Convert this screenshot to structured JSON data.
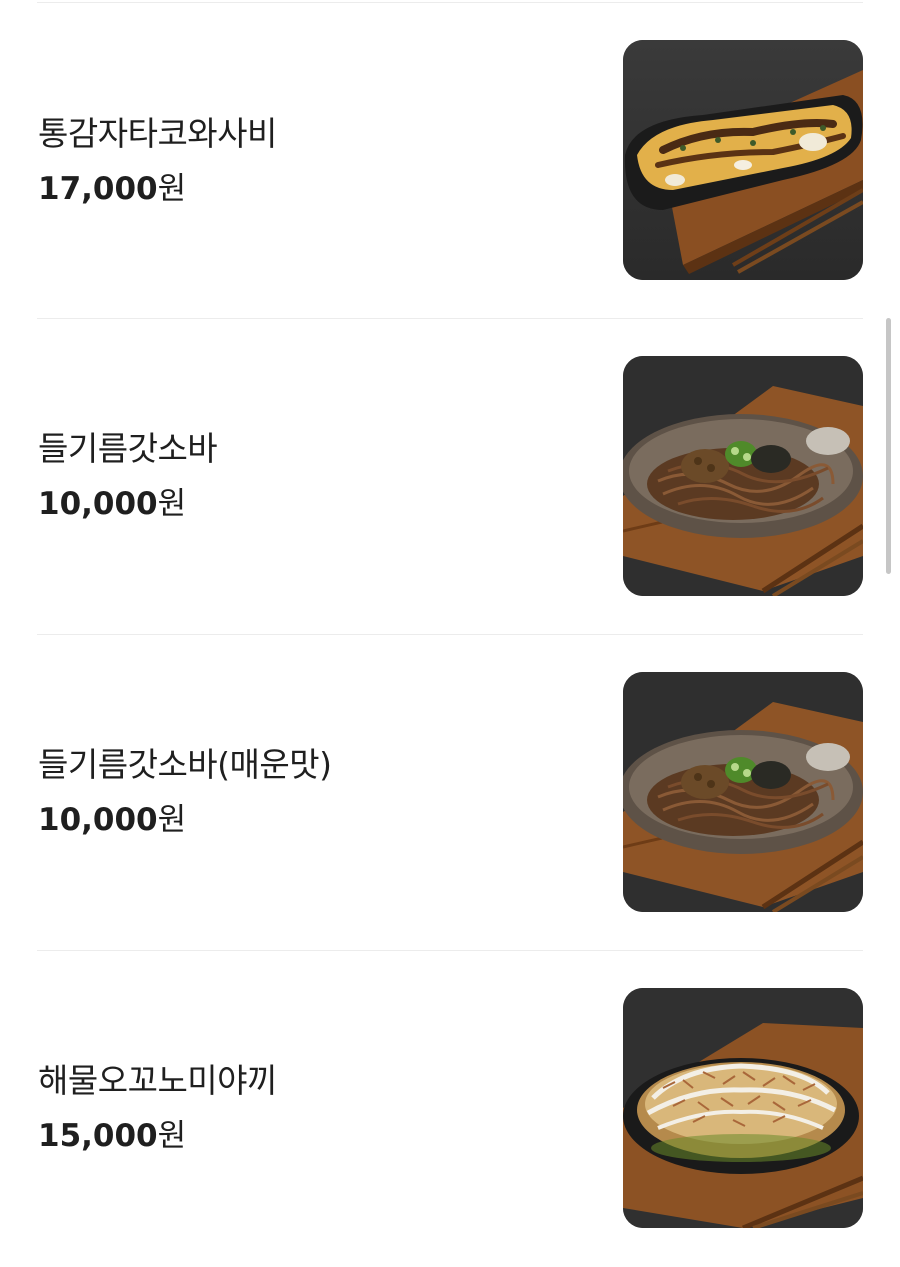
{
  "menu": {
    "items": [
      {
        "name": "통감자타코와사비",
        "price_number": "17,000",
        "price_unit": "원",
        "image": "potato-takowasabi-photo"
      },
      {
        "name": "들기름갓소바",
        "price_number": "10,000",
        "price_unit": "원",
        "image": "perilla-oil-soba-photo"
      },
      {
        "name": "들기름갓소바(매운맛)",
        "price_number": "10,000",
        "price_unit": "원",
        "image": "perilla-oil-soba-spicy-photo"
      },
      {
        "name": "해물오꼬노미야끼",
        "price_number": "15,000",
        "price_unit": "원",
        "image": "seafood-okonomiyaki-photo"
      }
    ]
  },
  "colors": {
    "background": "#ffffff",
    "text": "#1f1f1f",
    "divider": "#ececec",
    "photo_backdrop": "#2c2c2c",
    "scrollbar": "#c6c6c6"
  }
}
